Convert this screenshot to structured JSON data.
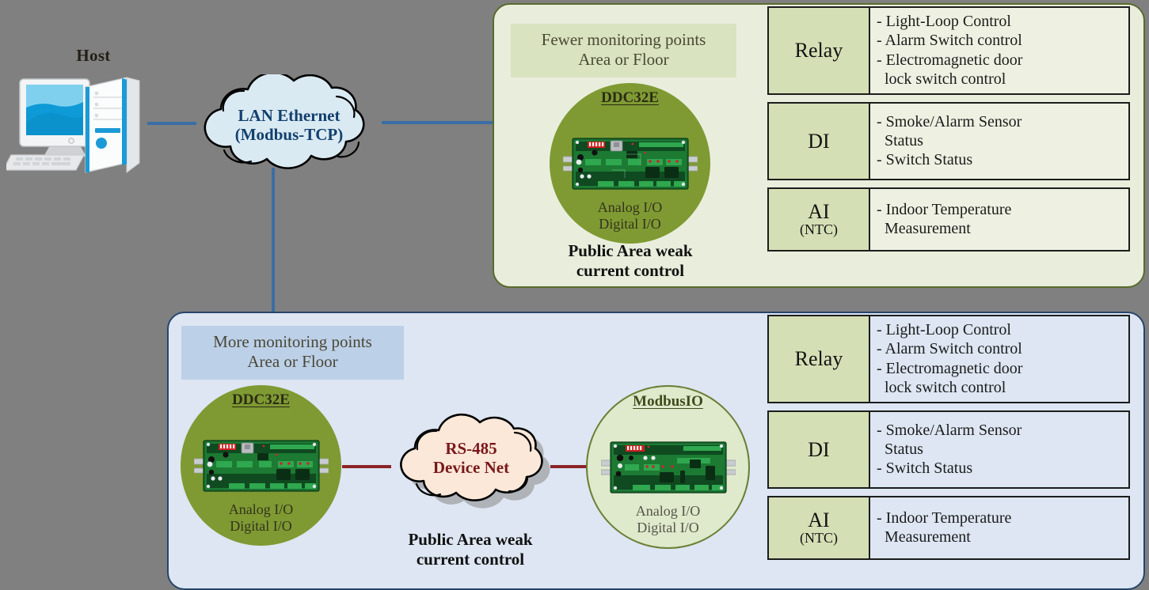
{
  "host": {
    "label": "Host",
    "icon": "desktop-computer-icon"
  },
  "clouds": {
    "lan": {
      "line1": "LAN Ethernet",
      "line2": "(Modbus-TCP)",
      "color": "#12406e",
      "fill": "#daeaf3"
    },
    "rs485": {
      "line1": "RS-485",
      "line2": "Device Net",
      "color": "#78181b",
      "fill": "#fce8d8"
    }
  },
  "panel_top": {
    "header_line1": "Fewer monitoring points",
    "header_line2": "Area or Floor",
    "caption_line1": "Public Area weak",
    "caption_line2": "current control",
    "border_color": "#5a6b2f",
    "fill": "#e9eedc",
    "device": {
      "title": "DDC32E",
      "io_line1": "Analog I/O",
      "io_line2": "Digital I/O",
      "circle_fill": "#7f9a33"
    },
    "io_rows": [
      {
        "label": "Relay",
        "sub": "",
        "lines": [
          "- Light-Loop Control",
          "- Alarm Switch control",
          "- Electromagnetic door",
          "  lock switch control"
        ]
      },
      {
        "label": "DI",
        "sub": "",
        "lines": [
          "- Smoke/Alarm Sensor",
          "  Status",
          "- Switch Status"
        ]
      },
      {
        "label": "AI",
        "sub": "(NTC)",
        "lines": [
          "- Indoor Temperature",
          "  Measurement"
        ]
      }
    ]
  },
  "panel_bottom": {
    "header_line1": "More monitoring points",
    "header_line2": "Area or Floor",
    "caption_line1": "Public Area weak",
    "caption_line2": "current control",
    "border_color": "#27456b",
    "fill": "#dde6f2",
    "device_primary": {
      "title": "DDC32E",
      "io_line1": "Analog I/O",
      "io_line2": "Digital I/O",
      "circle_fill": "#7f9a33"
    },
    "device_secondary": {
      "title": "ModbusIO",
      "io_line1": "Analog I/O",
      "io_line2": "Digital I/O",
      "circle_fill": "#dfe9cb"
    },
    "io_rows": [
      {
        "label": "Relay",
        "sub": "",
        "lines": [
          "- Light-Loop Control",
          "- Alarm Switch control",
          "- Electromagnetic door",
          "  lock switch control"
        ]
      },
      {
        "label": "DI",
        "sub": "",
        "lines": [
          "- Smoke/Alarm Sensor",
          "  Status",
          "- Switch Status"
        ]
      },
      {
        "label": "AI",
        "sub": "(NTC)",
        "lines": [
          "- Indoor Temperature",
          "  Measurement"
        ]
      }
    ]
  },
  "links": {
    "host_to_lan": "ethernet-link",
    "lan_to_top_panel": "ethernet-link",
    "lan_to_bottom_panel": "ethernet-link",
    "ddc_to_rs485": "rs485-link",
    "rs485_to_modbusio": "rs485-link",
    "ethernet_color": "#3a6ea5",
    "rs485_color": "#8b2327"
  }
}
